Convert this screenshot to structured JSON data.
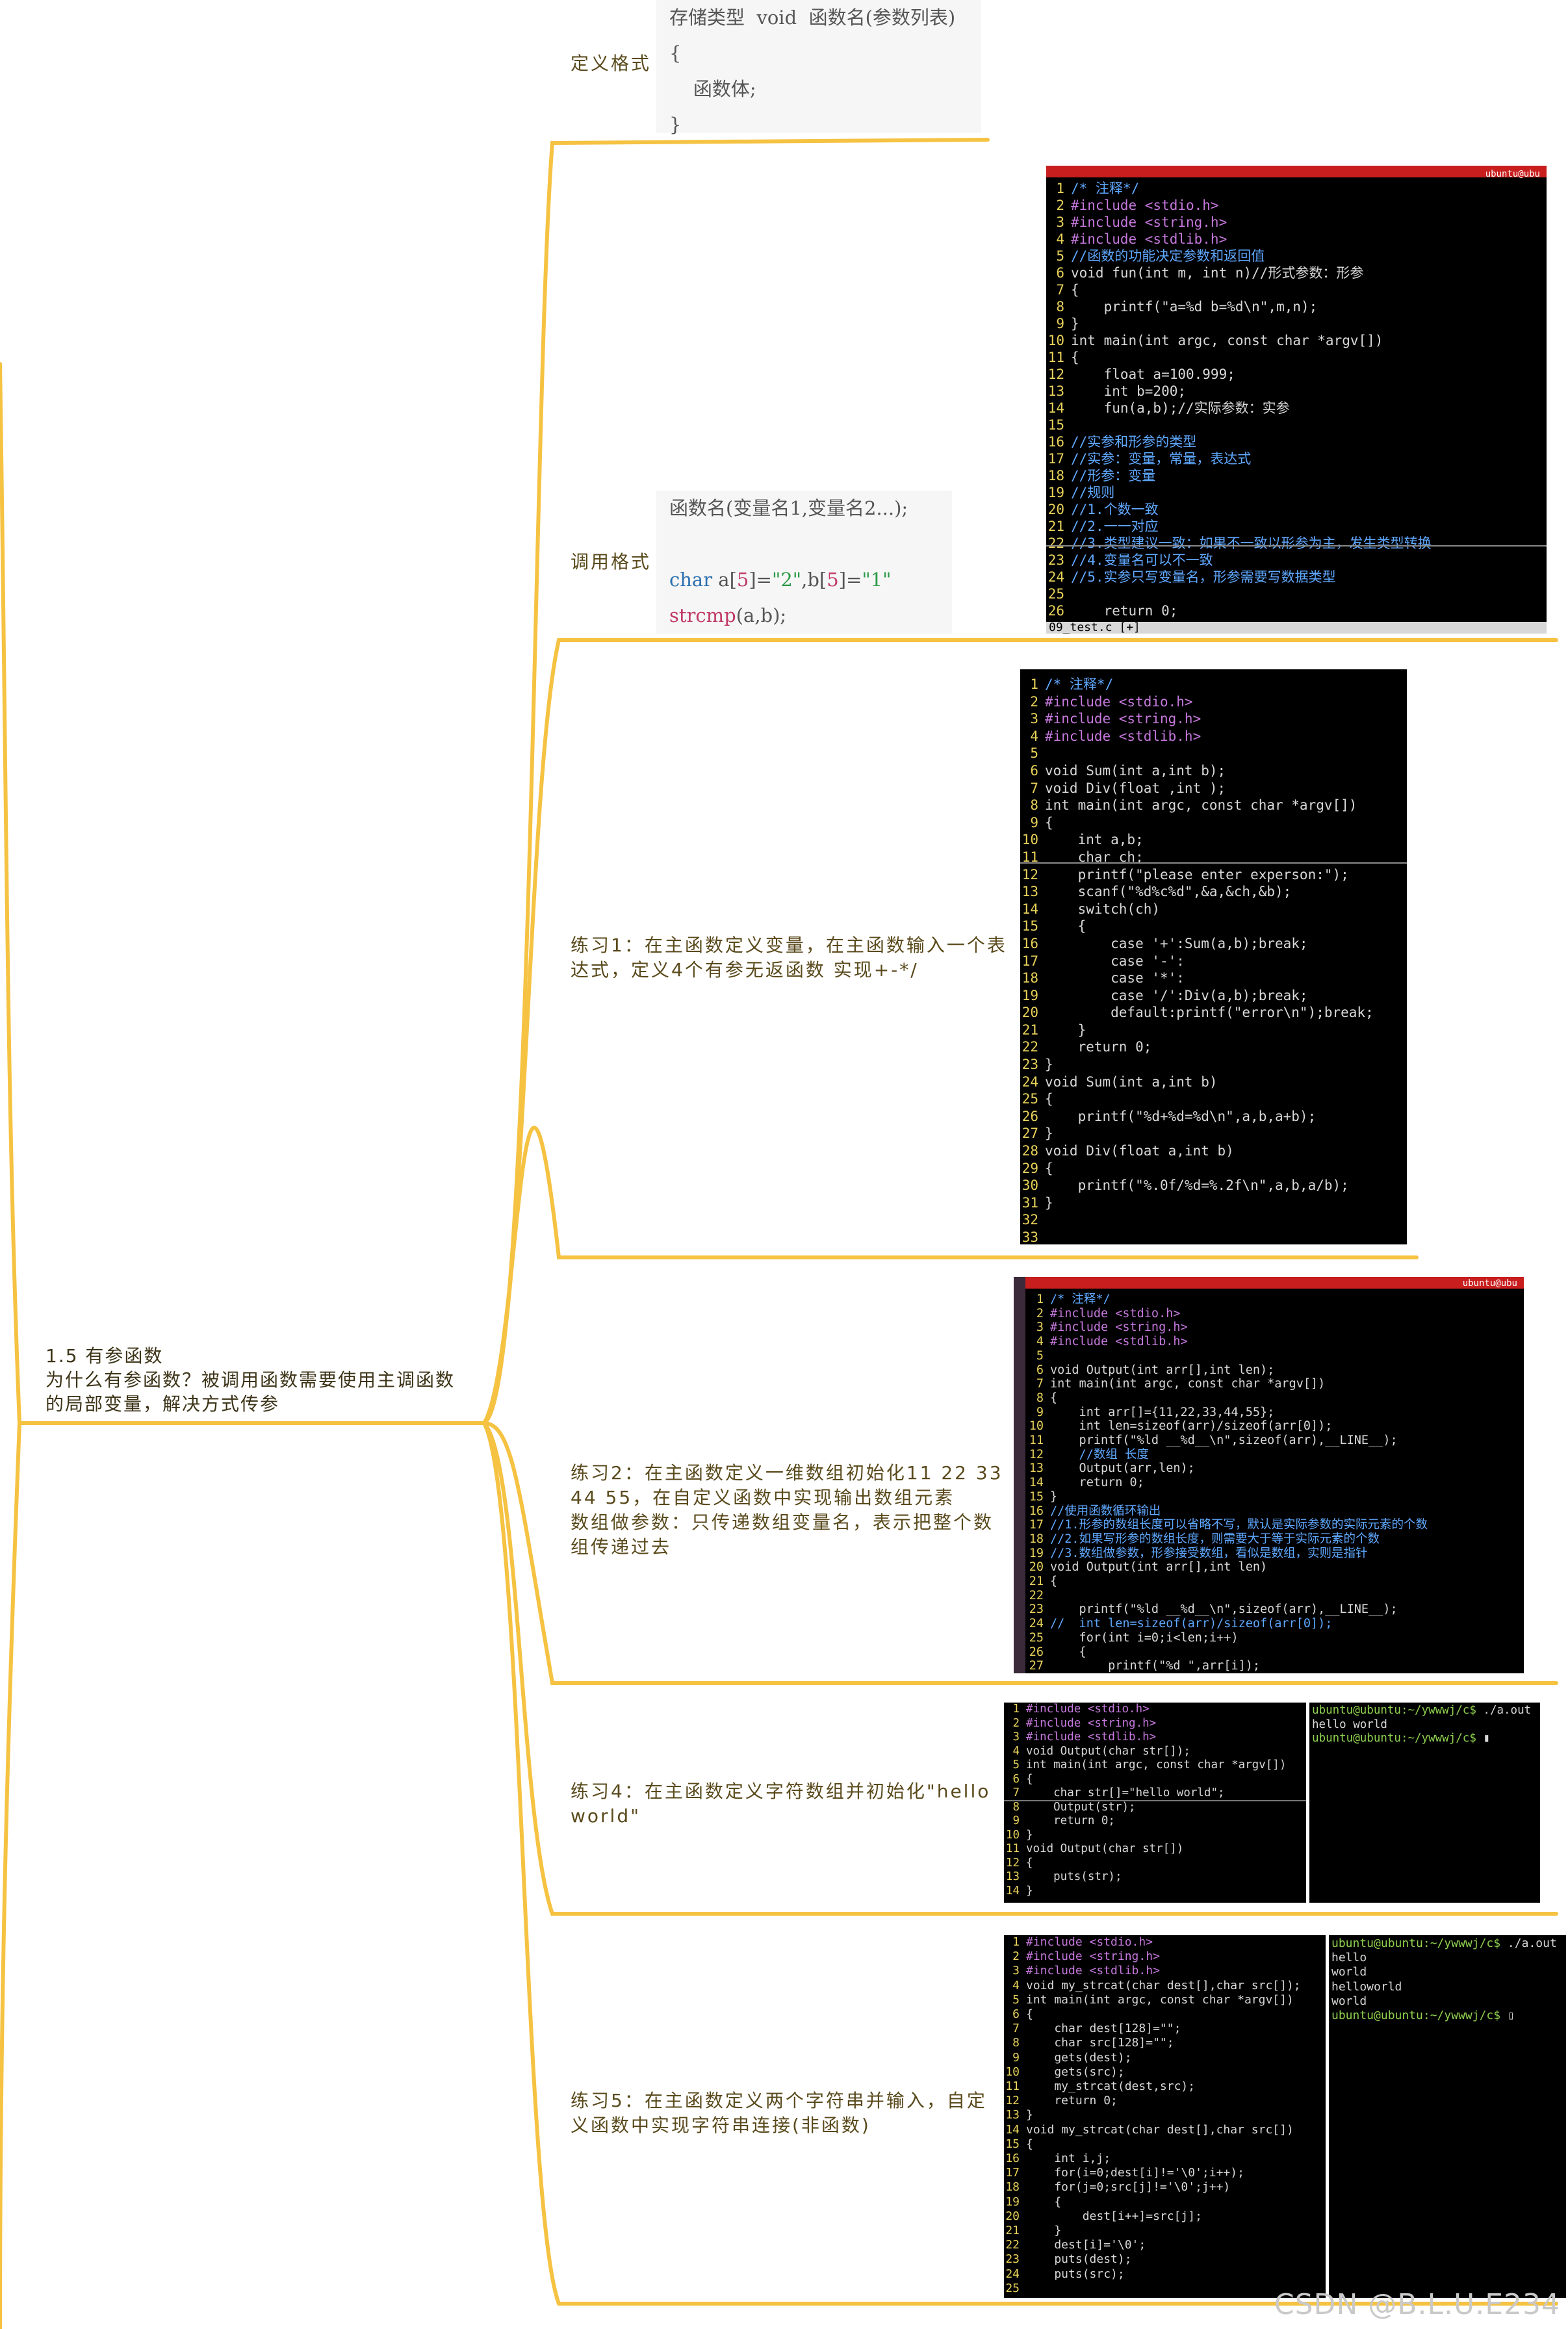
{
  "root": {
    "title": "1.5 有参函数",
    "line2": "为什么有参函数？被调用函数需要使用主调函数",
    "line3": "的局部变量，解决方式传参"
  },
  "branches": {
    "define_format": "定义格式",
    "call_format": "调用格式",
    "exercise1_line1": "练习1：在主函数定义变量，在主函数输入一个表",
    "exercise1_line2": "达式，定义4个有参无返函数 实现+-*/",
    "exercise2_line1": "练习2：在主函数定义一维数组初始化11 22 33",
    "exercise2_line2": "44 55，在自定义函数中实现输出数组元素",
    "exercise2_line3": "数组做参数：只传递数组变量名，表示把整个数",
    "exercise2_line4": "组传递过去",
    "exercise4_line1": "练习4：在主函数定义字符数组并初始化\"hello",
    "exercise4_line2": "world\"",
    "exercise5_line1": "练习5：在主函数定义两个字符串并输入，自定",
    "exercise5_line2": "义函数中实现字符串连接(非函数)"
  },
  "define_code": {
    "l1_a": "存储类型",
    "l1_kw": "void",
    "l1_b": "函数名(参数列表)",
    "l2": "{",
    "l3": "    函数体;",
    "l4": "}"
  },
  "call_code": {
    "l1": "函数名(变量名1,变量名2...);",
    "l2_kw": "char",
    "l2_a": " a[",
    "l2_n1": "5",
    "l2_b": "]=",
    "l2_s1": "\"2\"",
    "l2_c": ",b[",
    "l2_n2": "5",
    "l2_d": "]=",
    "l2_s2": "\"1\"",
    "l3_fn": "strcmp",
    "l3_rest": "(a,b);"
  },
  "terminal1": {
    "title": "ubuntu@ubu",
    "status": "09_test.c [+]",
    "lines": [
      [
        "1",
        "/* 注释*/"
      ],
      [
        "2",
        "#include <stdio.h>"
      ],
      [
        "3",
        "#include <string.h>"
      ],
      [
        "4",
        "#include <stdlib.h>"
      ],
      [
        "5",
        "//函数的功能决定参数和返回值"
      ],
      [
        "6",
        "void fun(int m, int n)//形式参数：形参"
      ],
      [
        "7",
        "{"
      ],
      [
        "8",
        "    printf(\"a=%d b=%d\\n\",m,n);"
      ],
      [
        "9",
        "}"
      ],
      [
        "10",
        "int main(int argc, const char *argv[])"
      ],
      [
        "11",
        "{"
      ],
      [
        "12",
        "    float a=100.999;"
      ],
      [
        "13",
        "    int b=200;"
      ],
      [
        "14",
        "    fun(a,b);//实际参数：实参"
      ],
      [
        "15",
        ""
      ],
      [
        "16",
        "//实参和形参的类型"
      ],
      [
        "17",
        "//实参：变量，常量，表达式"
      ],
      [
        "18",
        "//形参：变量"
      ],
      [
        "19",
        "//规则"
      ],
      [
        "20",
        "//1.个数一致"
      ],
      [
        "21",
        "//2.一一对应"
      ],
      [
        "22",
        "//3.类型建议一致：如果不一致以形参为主，发生类型转换"
      ],
      [
        "23",
        "//4.变量名可以不一致"
      ],
      [
        "24",
        "//5.实参只写变量名，形参需要写数据类型"
      ],
      [
        "25",
        ""
      ],
      [
        "26",
        "    return 0;"
      ]
    ]
  },
  "terminal2": {
    "lines": [
      [
        "1",
        "/* 注释*/"
      ],
      [
        "2",
        "#include <stdio.h>"
      ],
      [
        "3",
        "#include <string.h>"
      ],
      [
        "4",
        "#include <stdlib.h>"
      ],
      [
        "5",
        ""
      ],
      [
        "6",
        "void Sum(int a,int b);"
      ],
      [
        "7",
        "void Div(float ,int );"
      ],
      [
        "8",
        "int main(int argc, const char *argv[])"
      ],
      [
        "9",
        "{"
      ],
      [
        "10",
        "    int a,b;"
      ],
      [
        "11",
        "    char ch;"
      ],
      [
        "12",
        "    printf(\"please enter experson:\");"
      ],
      [
        "13",
        "    scanf(\"%d%c%d\",&a,&ch,&b);"
      ],
      [
        "14",
        "    switch(ch)"
      ],
      [
        "15",
        "    {"
      ],
      [
        "16",
        "        case '+':Sum(a,b);break;"
      ],
      [
        "17",
        "        case '-':"
      ],
      [
        "18",
        "        case '*':"
      ],
      [
        "19",
        "        case '/':Div(a,b);break;"
      ],
      [
        "20",
        "        default:printf(\"error\\n\");break;"
      ],
      [
        "21",
        "    }"
      ],
      [
        "22",
        "    return 0;"
      ],
      [
        "23",
        "}"
      ],
      [
        "24",
        "void Sum(int a,int b)"
      ],
      [
        "25",
        "{"
      ],
      [
        "26",
        "    printf(\"%d+%d=%d\\n\",a,b,a+b);"
      ],
      [
        "27",
        "}"
      ],
      [
        "28",
        "void Div(float a,int b)"
      ],
      [
        "29",
        "{"
      ],
      [
        "30",
        "    printf(\"%.0f/%d=%.2f\\n\",a,b,a/b);"
      ],
      [
        "31",
        "}"
      ],
      [
        "32",
        ""
      ],
      [
        "33",
        ""
      ]
    ]
  },
  "terminal3": {
    "title": "ubuntu@ubu",
    "lines": [
      [
        "1",
        "/* 注释*/"
      ],
      [
        "2",
        "#include <stdio.h>"
      ],
      [
        "3",
        "#include <string.h>"
      ],
      [
        "4",
        "#include <stdlib.h>"
      ],
      [
        "5",
        ""
      ],
      [
        "6",
        "void Output(int arr[],int len);"
      ],
      [
        "7",
        "int main(int argc, const char *argv[])"
      ],
      [
        "8",
        "{"
      ],
      [
        "9",
        "    int arr[]={11,22,33,44,55};"
      ],
      [
        "10",
        "    int len=sizeof(arr)/sizeof(arr[0]);"
      ],
      [
        "11",
        "    printf(\"%ld __%d__\\n\",sizeof(arr),__LINE__);"
      ],
      [
        "12",
        "    //数组 长度"
      ],
      [
        "13",
        "    Output(arr,len);"
      ],
      [
        "14",
        "    return 0;"
      ],
      [
        "15",
        "}"
      ],
      [
        "16",
        "//使用函数循环输出"
      ],
      [
        "17",
        "//1.形参的数组长度可以省略不写，默认是实际参数的实际元素的个数"
      ],
      [
        "18",
        "//2.如果写形参的数组长度，则需要大于等于实际元素的个数"
      ],
      [
        "19",
        "//3.数组做参数，形参接受数组，看似是数组，实则是指针"
      ],
      [
        "20",
        "void Output(int arr[],int len)"
      ],
      [
        "21",
        "{"
      ],
      [
        "22",
        ""
      ],
      [
        "23",
        "    printf(\"%ld __%d__\\n\",sizeof(arr),__LINE__);"
      ],
      [
        "24",
        "//  int len=sizeof(arr)/sizeof(arr[0]);"
      ],
      [
        "25",
        "    for(int i=0;i<len;i++)"
      ],
      [
        "26",
        "    {"
      ],
      [
        "27",
        "        printf(\"%d \",arr[i]);"
      ]
    ]
  },
  "terminal4": {
    "lines": [
      [
        "1",
        "#include <stdio.h>"
      ],
      [
        "2",
        "#include <string.h>"
      ],
      [
        "3",
        "#include <stdlib.h>"
      ],
      [
        "4",
        "void Output(char str[]);"
      ],
      [
        "5",
        "int main(int argc, const char *argv[])"
      ],
      [
        "6",
        "{"
      ],
      [
        "7",
        "    char str[]=\"hello world\";"
      ],
      [
        "8",
        "    Output(str);"
      ],
      [
        "9",
        "    return 0;"
      ],
      [
        "10",
        "}"
      ],
      [
        "11",
        "void Output(char str[])"
      ],
      [
        "12",
        "{"
      ],
      [
        "13",
        "    puts(str);"
      ],
      [
        "14",
        "}"
      ]
    ],
    "out_prompt1": "ubuntu@ubuntu:~/ywwwj/c$",
    "out_cmd1": " ./a.out",
    "out_line1": "hello world",
    "out_prompt2": "ubuntu@ubuntu:~/ywwwj/c$"
  },
  "terminal5": {
    "lines": [
      [
        "1",
        "#include <stdio.h>"
      ],
      [
        "2",
        "#include <string.h>"
      ],
      [
        "3",
        "#include <stdlib.h>"
      ],
      [
        "4",
        "void my_strcat(char dest[],char src[]);"
      ],
      [
        "5",
        "int main(int argc, const char *argv[])"
      ],
      [
        "6",
        "{"
      ],
      [
        "7",
        "    char dest[128]=\"\";"
      ],
      [
        "8",
        "    char src[128]=\"\";"
      ],
      [
        "9",
        "    gets(dest);"
      ],
      [
        "10",
        "    gets(src);"
      ],
      [
        "11",
        "    my_strcat(dest,src);"
      ],
      [
        "12",
        "    return 0;"
      ],
      [
        "13",
        "}"
      ],
      [
        "14",
        "void my_strcat(char dest[],char src[])"
      ],
      [
        "15",
        "{"
      ],
      [
        "16",
        "    int i,j;"
      ],
      [
        "17",
        "    for(i=0;dest[i]!='\\0';i++);"
      ],
      [
        "18",
        "    for(j=0;src[j]!='\\0';j++)"
      ],
      [
        "19",
        "    {"
      ],
      [
        "20",
        "        dest[i++]=src[j];"
      ],
      [
        "21",
        "    }"
      ],
      [
        "22",
        "    dest[i]='\\0';"
      ],
      [
        "23",
        "    puts(dest);"
      ],
      [
        "24",
        "    puts(src);"
      ],
      [
        "25",
        ""
      ]
    ],
    "out_prompt1": "ubuntu@ubuntu:~/ywwwj/c$",
    "out_cmd1": " ./a.out",
    "out_lines": [
      "hello",
      "world",
      "helloworld",
      "world"
    ],
    "out_prompt2": "ubuntu@ubuntu:~/ywwwj/c$"
  },
  "watermark": "CSDN @B.L.U.E234",
  "colors": {
    "connector": "#f5c242",
    "terminal_bg": "#000000",
    "line_number": "#e8d25a"
  }
}
